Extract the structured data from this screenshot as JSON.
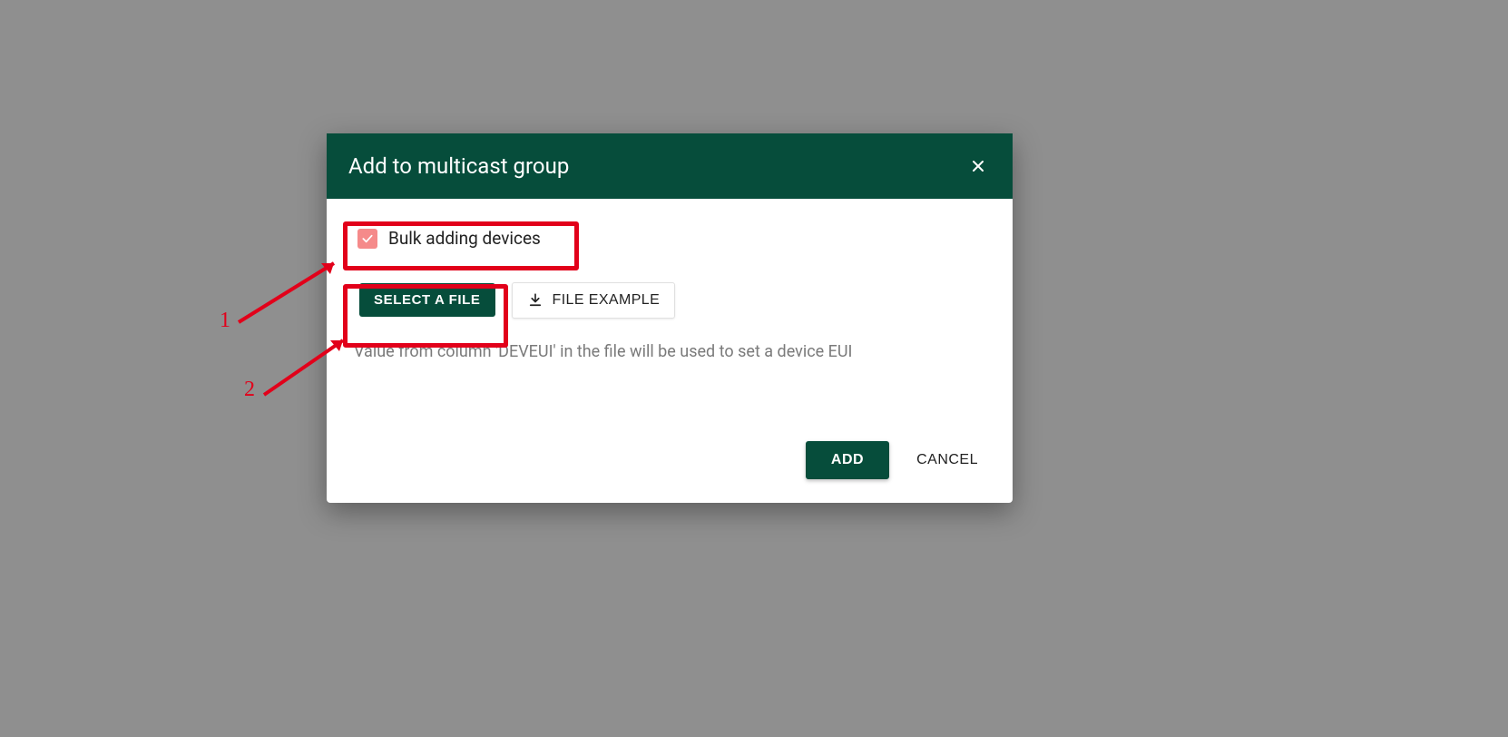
{
  "dialog": {
    "title": "Add to multicast group",
    "checkbox_label": "Bulk adding devices",
    "select_file_label": "SELECT A FILE",
    "file_example_label": "FILE EXAMPLE",
    "hint": "Value from column 'DEVEUI' in the file will be used to set a device EUI",
    "add_label": "ADD",
    "cancel_label": "CANCEL"
  },
  "annotations": {
    "label1": "1",
    "label2": "2"
  },
  "colors": {
    "primary": "#064d3b",
    "accent_checkbox": "#f58a8a",
    "annotation_red": "#e2001a"
  }
}
